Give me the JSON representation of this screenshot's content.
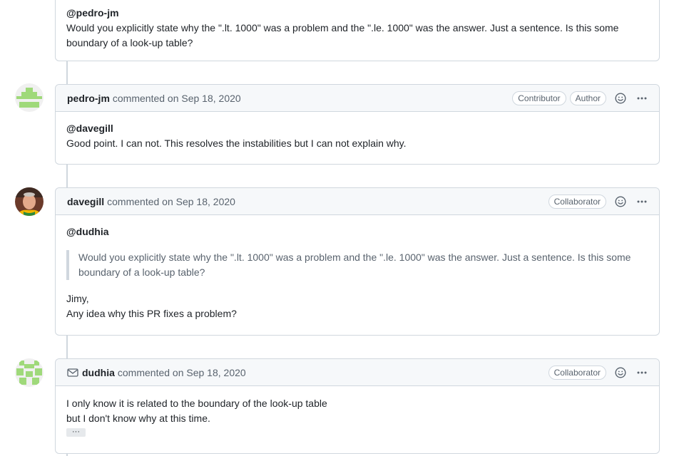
{
  "comments": [
    {
      "mention": "@pedro-jm",
      "text": "Would you explicitly state why the \".lt. 1000\" was a problem and the \".le. 1000\" was the answer. Just a sentence. Is this some boundary of a look-up table?"
    },
    {
      "author": "pedro-jm",
      "meta": "commented on Sep 18, 2020",
      "labels": [
        "Contributor",
        "Author"
      ],
      "mention": "@davegill",
      "text": "Good point. I can not. This resolves the instabilities but I can not explain why."
    },
    {
      "author": "davegill",
      "meta": "commented on Sep 18, 2020",
      "labels": [
        "Collaborator"
      ],
      "mention": "@dudhia",
      "quote": "Would you explicitly state why the \".lt. 1000\" was a problem and the \".le. 1000\" was the answer. Just a sentence. Is this some boundary of a look-up table?",
      "line1": "Jimy,",
      "line2": "Any idea why this PR fixes a problem?"
    },
    {
      "author": "dudhia",
      "meta": "commented on Sep 18, 2020",
      "labels": [
        "Collaborator"
      ],
      "line1": "I only know it is related to the boundary of the look-up table",
      "line2": "but I don't know why at this time.",
      "expander": "···"
    }
  ],
  "icons": {
    "emoji": "smiley-icon",
    "menu": "kebab-horizontal-icon",
    "mail": "mail-icon"
  },
  "colors": {
    "border": "#d0d7de",
    "header_bg": "#f6f8fa",
    "muted_text": "#59636e",
    "identicon_green": "#9fd97a"
  }
}
